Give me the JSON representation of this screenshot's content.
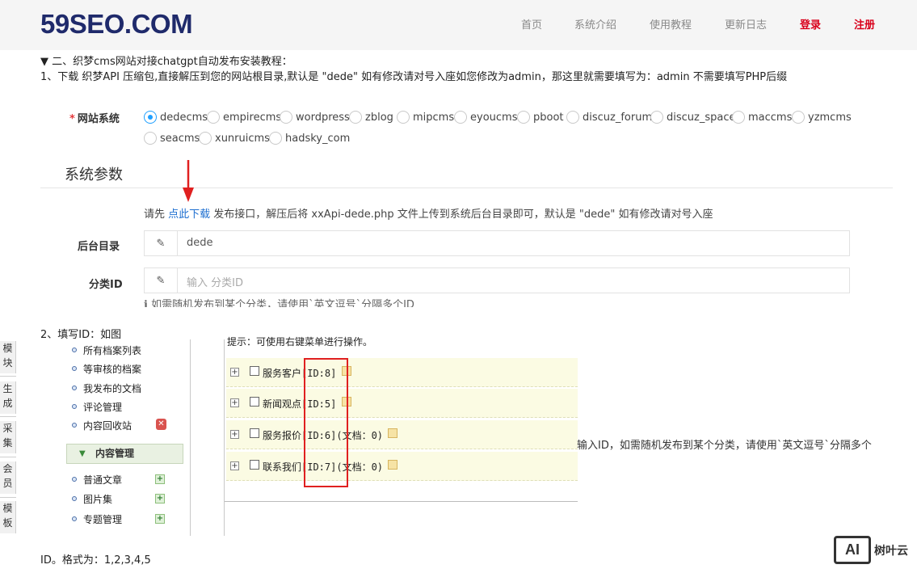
{
  "header": {
    "logo": "59SEO.COM",
    "nav": [
      "首页",
      "系统介绍",
      "使用教程",
      "更新日志"
    ],
    "login": "登录",
    "register": "注册"
  },
  "tutorial": {
    "heading": "▼ 二、织梦cms网站对接chatgpt自动发布安装教程：",
    "step1": "1、下载 织梦API 压缩包,直接解压到您的网站根目录,默认是 \"dede\" 如有修改请对号入座如您修改为admin，那这里就需要填写为：admin 不需要填写PHP后缀",
    "step2": "2、填写ID：如图",
    "footer": "ID。格式为：1,2,3,4,5"
  },
  "form": {
    "site_label": "网站系统",
    "systems": [
      "dedecms",
      "empirecms",
      "wordpress",
      "zblog",
      "mipcms",
      "eyoucms",
      "pboot",
      "discuz_forum",
      "discuz_space",
      "maccms",
      "yzmcms",
      "seacms",
      "xunruicms",
      "hadsky_com"
    ],
    "selected_system": "dedecms",
    "section_title": "系统参数",
    "note_prefix": "请先 ",
    "note_link": "点此下载",
    "note_suffix": " 发布接口，解压后将 xxApi-dede.php 文件上传到系统后台目录即可，默认是 \"dede\" 如有修改请对号入座",
    "backend_label": "后台目录",
    "backend_value": "dede",
    "category_label": "分类ID",
    "category_placeholder": "输入 分类ID",
    "category_hint": "ℹ 如需随机发布到某个分类，请使用`英文逗号`分隔多个ID"
  },
  "embedded": {
    "side_tabs": [
      "模块",
      "生成",
      "采集",
      "会员",
      "模板"
    ],
    "menu_items": [
      "所有档案列表",
      "等审核的档案",
      "我发布的文档",
      "评论管理",
      "内容回收站"
    ],
    "menu_section": "内容管理",
    "menu_sub": [
      "普通文章",
      "图片集",
      "专题管理"
    ],
    "tip": "提示：可使用右键菜单进行操作。",
    "categories": [
      "服务客户[ID:8]",
      "新闻观点[ID:5]",
      "服务报价[ID:6](文档：0)",
      "联系我们[ID:7](文档：0)"
    ],
    "side_note": "输入ID，如需随机发布到某个分类，请使用`英文逗号`分隔多个"
  },
  "watermark": {
    "badge": "AI",
    "text": "树叶云"
  },
  "colors": {
    "brand": "#1f2a6b",
    "accent_red": "#d9001b",
    "link": "#1e6fd0",
    "radio_selected": "#1e9fff"
  }
}
